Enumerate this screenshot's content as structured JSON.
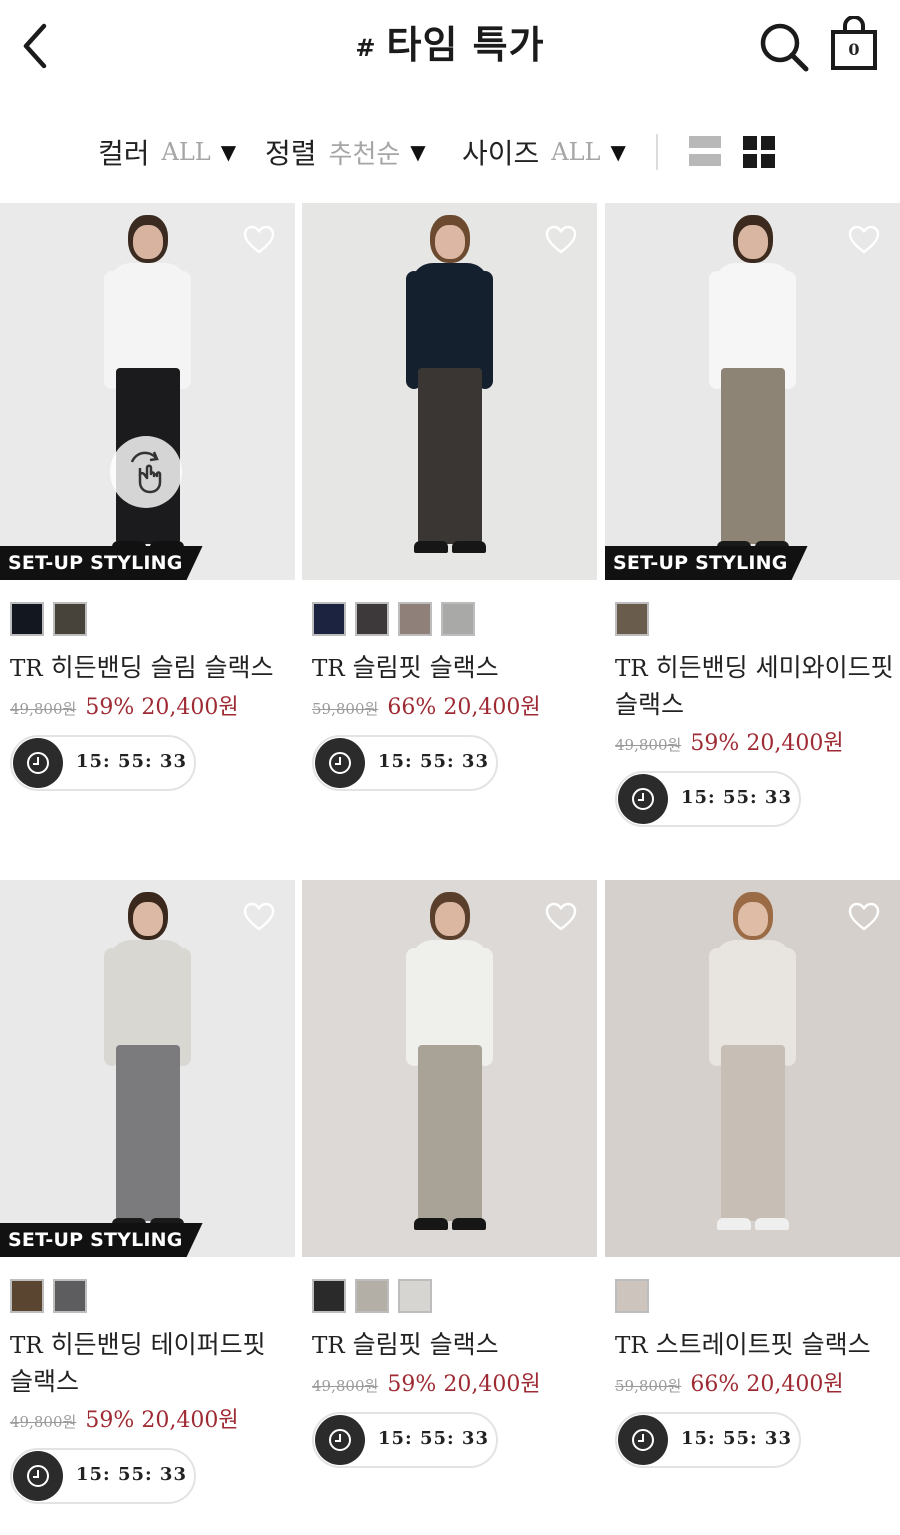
{
  "header": {
    "title_hash": "#",
    "title": "타임 특가",
    "cart_count": "0"
  },
  "filters": {
    "color": {
      "label": "컬러",
      "value": "ALL"
    },
    "sort": {
      "label": "정렬",
      "value": "추천순"
    },
    "size": {
      "label": "사이즈",
      "value": "ALL"
    },
    "caret": "▼"
  },
  "products": [
    {
      "name_prefix": "TR",
      "name": "히든밴딩 슬림 슬랙스",
      "original_price": "49,800원",
      "discount": "59%",
      "sale_price": "20,400원",
      "badge": "SET-UP STYLING",
      "timer": "15: 55: 33",
      "swatches": [
        "#121720",
        "#48433a"
      ],
      "colors": {
        "bg": "#eaeaea",
        "top": "#f4f4f4",
        "pants": "#1b1b1d",
        "hair": "#3a2a1f",
        "skin": "#d8b4a0",
        "shoe": "#111111"
      }
    },
    {
      "name_prefix": "TR",
      "name": "슬림핏 슬랙스",
      "original_price": "59,800원",
      "discount": "66%",
      "sale_price": "20,400원",
      "badge": "",
      "timer": "15: 55: 33",
      "swatches": [
        "#1c2340",
        "#3d393a",
        "#8f8179",
        "#a9a9a7"
      ],
      "colors": {
        "bg": "#e6e7e5",
        "top": "#15202e",
        "pants": "#3a3634",
        "hair": "#6b4a30",
        "skin": "#dcb7a3",
        "shoe": "#161616"
      }
    },
    {
      "name_prefix": "TR",
      "name": "히든밴딩 세미와이드핏 슬랙스",
      "original_price": "49,800원",
      "discount": "59%",
      "sale_price": "20,400원",
      "badge": "SET-UP STYLING",
      "timer": "15: 55: 33",
      "swatches": [
        "#6a5c4d"
      ],
      "colors": {
        "bg": "#e8e8e8",
        "top": "#f6f6f6",
        "pants": "#8e8476",
        "hair": "#3b2a1d",
        "skin": "#d9b6a1",
        "shoe": "#1a1a1a"
      }
    },
    {
      "name_prefix": "TR",
      "name": "히든밴딩 테이퍼드핏 슬랙스",
      "original_price": "49,800원",
      "discount": "59%",
      "sale_price": "20,400원",
      "badge": "SET-UP STYLING",
      "timer": "15: 55: 33",
      "swatches": [
        "#5a4630",
        "#5d5d60"
      ],
      "colors": {
        "bg": "#e9e9e9",
        "top": "#d9d7d2",
        "pants": "#7b7b7d",
        "hair": "#3a281c",
        "skin": "#dcb9a5",
        "shoe": "#1a1a1a"
      }
    },
    {
      "name_prefix": "TR",
      "name": "슬림핏 슬랙스",
      "original_price": "49,800원",
      "discount": "59%",
      "sale_price": "20,400원",
      "badge": "",
      "timer": "15: 55: 33",
      "swatches": [
        "#2a2a2a",
        "#b3aea6",
        "#d6d5d1"
      ],
      "colors": {
        "bg": "#ddd9d6",
        "top": "#efefec",
        "pants": "#a9a397",
        "hair": "#5a402c",
        "skin": "#dbb7a2",
        "shoe": "#161616"
      }
    },
    {
      "name_prefix": "TR",
      "name": "스트레이트핏 슬랙스",
      "original_price": "59,800원",
      "discount": "66%",
      "sale_price": "20,400원",
      "badge": "",
      "timer": "15: 55: 33",
      "swatches": [
        "#ccc4bd"
      ],
      "colors": {
        "bg": "#d6d0cc",
        "top": "#e8e4df",
        "pants": "#c7bfb6",
        "hair": "#9a6b45",
        "skin": "#dfbca6",
        "shoe": "#efefef"
      }
    }
  ]
}
